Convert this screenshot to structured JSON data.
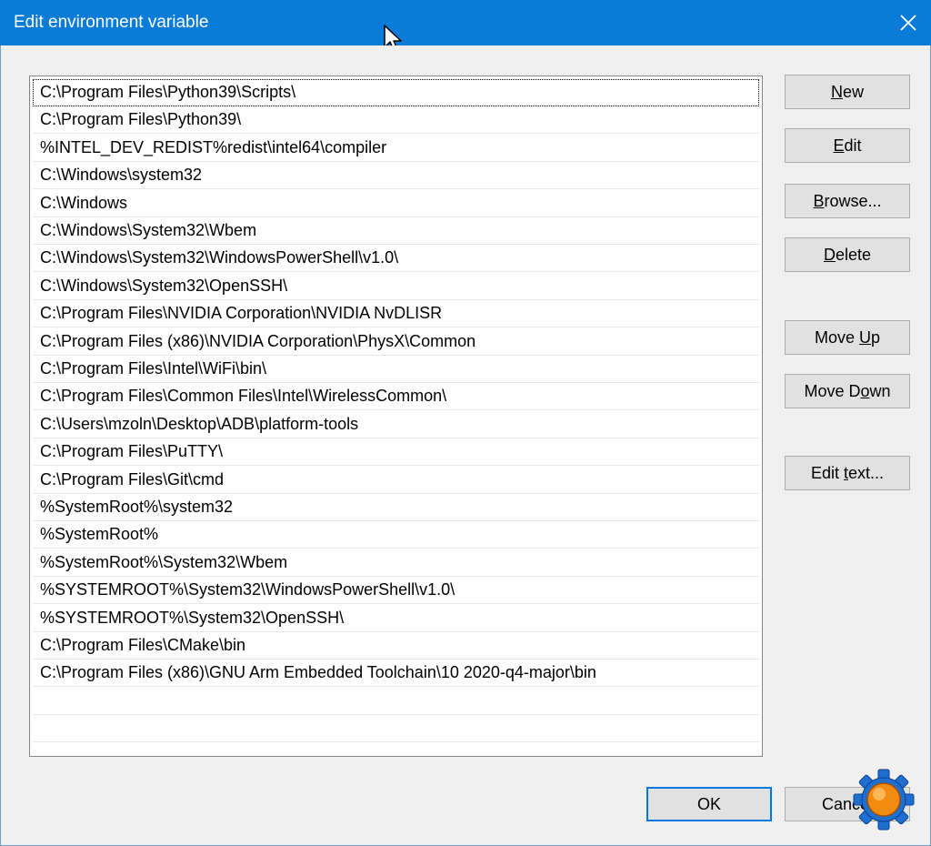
{
  "window": {
    "title": "Edit environment variable"
  },
  "paths": [
    "C:\\Program Files\\Python39\\Scripts\\",
    "C:\\Program Files\\Python39\\",
    "%INTEL_DEV_REDIST%redist\\intel64\\compiler",
    "C:\\Windows\\system32",
    "C:\\Windows",
    "C:\\Windows\\System32\\Wbem",
    "C:\\Windows\\System32\\WindowsPowerShell\\v1.0\\",
    "C:\\Windows\\System32\\OpenSSH\\",
    "C:\\Program Files\\NVIDIA Corporation\\NVIDIA NvDLISR",
    "C:\\Program Files (x86)\\NVIDIA Corporation\\PhysX\\Common",
    "C:\\Program Files\\Intel\\WiFi\\bin\\",
    "C:\\Program Files\\Common Files\\Intel\\WirelessCommon\\",
    "C:\\Users\\mzoln\\Desktop\\ADB\\platform-tools",
    "C:\\Program Files\\PuTTY\\",
    "C:\\Program Files\\Git\\cmd",
    "%SystemRoot%\\system32",
    "%SystemRoot%",
    "%SystemRoot%\\System32\\Wbem",
    "%SYSTEMROOT%\\System32\\WindowsPowerShell\\v1.0\\",
    "%SYSTEMROOT%\\System32\\OpenSSH\\",
    "C:\\Program Files\\CMake\\bin",
    "C:\\Program Files (x86)\\GNU Arm Embedded Toolchain\\10 2020-q4-major\\bin"
  ],
  "buttons": {
    "new": {
      "pre": "",
      "key": "N",
      "post": "ew"
    },
    "edit": {
      "pre": "",
      "key": "E",
      "post": "dit"
    },
    "browse": {
      "pre": "",
      "key": "B",
      "post": "rowse..."
    },
    "delete": {
      "pre": "",
      "key": "D",
      "post": "elete"
    },
    "move_up": {
      "pre": "Move ",
      "key": "U",
      "post": "p"
    },
    "move_down": {
      "pre": "Move D",
      "key": "o",
      "post": "wn"
    },
    "edit_text": {
      "pre": "Edit ",
      "key": "t",
      "post": "ext..."
    },
    "ok": "OK",
    "cancel": "Cancel"
  },
  "colors": {
    "titlebar": "#0a7bd6",
    "accent": "#0078d7"
  }
}
